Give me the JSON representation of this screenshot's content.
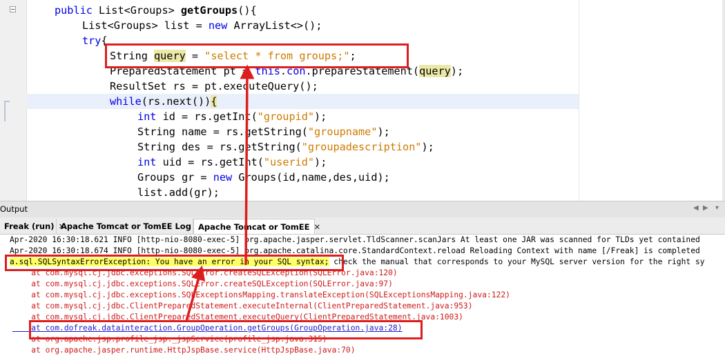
{
  "editor": {
    "lines": [
      {
        "indent": 0,
        "tokens": [
          {
            "t": "public ",
            "c": "kw"
          },
          {
            "t": "List<Groups> "
          },
          {
            "t": "getGroups",
            "c": "fn"
          },
          {
            "t": "(){"
          }
        ]
      },
      {
        "indent": 1,
        "tokens": [
          {
            "t": "List<Groups> list = "
          },
          {
            "t": "new ",
            "c": "kw"
          },
          {
            "t": "ArrayList<>();"
          }
        ]
      },
      {
        "indent": 1,
        "tokens": [
          {
            "t": "try",
            "c": "kw"
          },
          {
            "t": "{"
          }
        ]
      },
      {
        "indent": 2,
        "tokens": [
          {
            "t": "String "
          },
          {
            "t": "query",
            "c": "hl"
          },
          {
            "t": " = "
          },
          {
            "t": "\"select * from groups;\"",
            "c": "str"
          },
          {
            "t": ";"
          }
        ]
      },
      {
        "indent": 2,
        "tokens": [
          {
            "t": "PreparedStatement pt = "
          },
          {
            "t": "this",
            "c": "kw"
          },
          {
            "t": "."
          },
          {
            "t": "con",
            "c": "kw"
          },
          {
            "t": ".prepareStatement("
          },
          {
            "t": "query",
            "c": "hl"
          },
          {
            "t": ");"
          }
        ]
      },
      {
        "indent": 2,
        "tokens": [
          {
            "t": "ResultSet rs = pt.executeQuery();"
          }
        ]
      },
      {
        "indent": 2,
        "tokens": [
          {
            "t": "while",
            "c": "kw"
          },
          {
            "t": "(rs.next())"
          },
          {
            "t": "{",
            "c": "hl"
          }
        ]
      },
      {
        "indent": 3,
        "tokens": [
          {
            "t": "int ",
            "c": "kw"
          },
          {
            "t": "id = rs.getInt("
          },
          {
            "t": "\"groupid\"",
            "c": "str"
          },
          {
            "t": ");"
          }
        ]
      },
      {
        "indent": 3,
        "tokens": [
          {
            "t": "String name = rs.getString("
          },
          {
            "t": "\"groupname\"",
            "c": "str"
          },
          {
            "t": ");"
          }
        ]
      },
      {
        "indent": 3,
        "tokens": [
          {
            "t": "String des = rs.getString("
          },
          {
            "t": "\"groupadescription\"",
            "c": "str"
          },
          {
            "t": ");"
          }
        ]
      },
      {
        "indent": 3,
        "tokens": [
          {
            "t": "int ",
            "c": "kw"
          },
          {
            "t": "uid = rs.getInt("
          },
          {
            "t": "\"userid\"",
            "c": "str"
          },
          {
            "t": ");"
          }
        ]
      },
      {
        "indent": 3,
        "tokens": [
          {
            "t": "Groups gr = "
          },
          {
            "t": "new ",
            "c": "kw"
          },
          {
            "t": "Groups(id,name,des,uid);"
          }
        ]
      },
      {
        "indent": 3,
        "tokens": [
          {
            "t": "list.add(gr);"
          }
        ]
      }
    ]
  },
  "output": {
    "title": "Output",
    "tabs": [
      {
        "label": "Freak (run)",
        "closable": true,
        "active": false
      },
      {
        "label": "Apache Tomcat or TomEE Log",
        "closable": true,
        "active": false
      },
      {
        "label": "Apache Tomcat or TomEE",
        "closable": true,
        "active": true
      }
    ],
    "lines": [
      {
        "type": "info",
        "text": "Apr-2020 16:30:18.621 INFO [http-nio-8080-exec-5] org.apache.jasper.servlet.TldScanner.scanJars At least one JAR was scanned for TLDs yet contained"
      },
      {
        "type": "info",
        "text": "Apr-2020 16:30:18.674 INFO [http-nio-8080-exec-5] org.apache.catalina.core.StandardContext.reload Reloading Context with name [/Freak] is completed"
      },
      {
        "type": "exception",
        "highlight": "a.sql.SQLSyntaxErrorException: You have an error in your SQL syntax;",
        "rest": " check the manual that corresponds to your MySQL server version for the right sy"
      },
      {
        "type": "err",
        "text": "    at com.mysql.cj.jdbc.exceptions.SQLError.createSQLException(SQLError.java:120)"
      },
      {
        "type": "err",
        "text": "    at com.mysql.cj.jdbc.exceptions.SQLError.createSQLException(SQLError.java:97)"
      },
      {
        "type": "err",
        "text": "    at com.mysql.cj.jdbc.exceptions.SQLExceptionsMapping.translateException(SQLExceptionsMapping.java:122)"
      },
      {
        "type": "err",
        "text": "    at com.mysql.cj.jdbc.ClientPreparedStatement.executeInternal(ClientPreparedStatement.java:953)"
      },
      {
        "type": "err",
        "text": "    at com.mysql.cj.jdbc.ClientPreparedStatement.executeQuery(ClientPreparedStatement.java:1003)"
      },
      {
        "type": "link",
        "text": "    at com.dofreak.datainteraction.GroupOperation.getGroups(GroupOperation.java:28)"
      },
      {
        "type": "err",
        "text": "    at org.apache.jsp.profile_jsp._jspService(profile_jsp.java:315)"
      },
      {
        "type": "err",
        "text": "    at org.apache.jasper.runtime.HttpJspBase.service(HttpJspBase.java:70)"
      }
    ]
  }
}
